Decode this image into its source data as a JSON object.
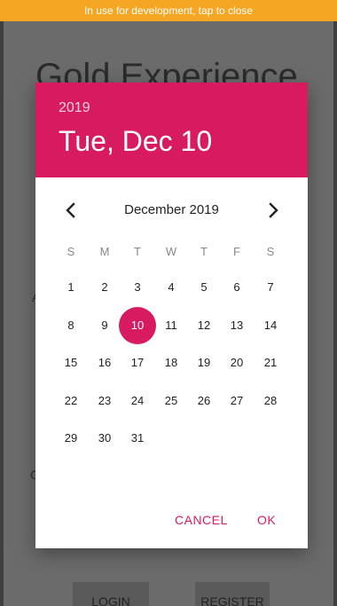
{
  "banner": {
    "text": "In use for development, tap to close"
  },
  "background": {
    "title": "Gold Experience",
    "fragments": [
      "A",
      "G"
    ],
    "login_label": "LOGIN",
    "register_label": "REGISTER"
  },
  "dialog": {
    "year": "2019",
    "selected_date": "Tue, Dec 10",
    "month_label": "December 2019",
    "prev_icon": "chevron-left-icon",
    "next_icon": "chevron-right-icon",
    "weekdays": [
      "S",
      "M",
      "T",
      "W",
      "T",
      "F",
      "S"
    ],
    "weeks": [
      [
        "1",
        "2",
        "3",
        "4",
        "5",
        "6",
        "7"
      ],
      [
        "8",
        "9",
        "10",
        "11",
        "12",
        "13",
        "14"
      ],
      [
        "15",
        "16",
        "17",
        "18",
        "19",
        "20",
        "21"
      ],
      [
        "22",
        "23",
        "24",
        "25",
        "26",
        "27",
        "28"
      ],
      [
        "29",
        "30",
        "31",
        "",
        "",
        "",
        ""
      ]
    ],
    "selected_day": "10",
    "cancel_label": "CANCEL",
    "ok_label": "OK",
    "accent_color": "#d81b60"
  },
  "colors": {
    "banner": "#f5a623",
    "accent": "#d81b60",
    "scrim": "#6b6b6b"
  }
}
